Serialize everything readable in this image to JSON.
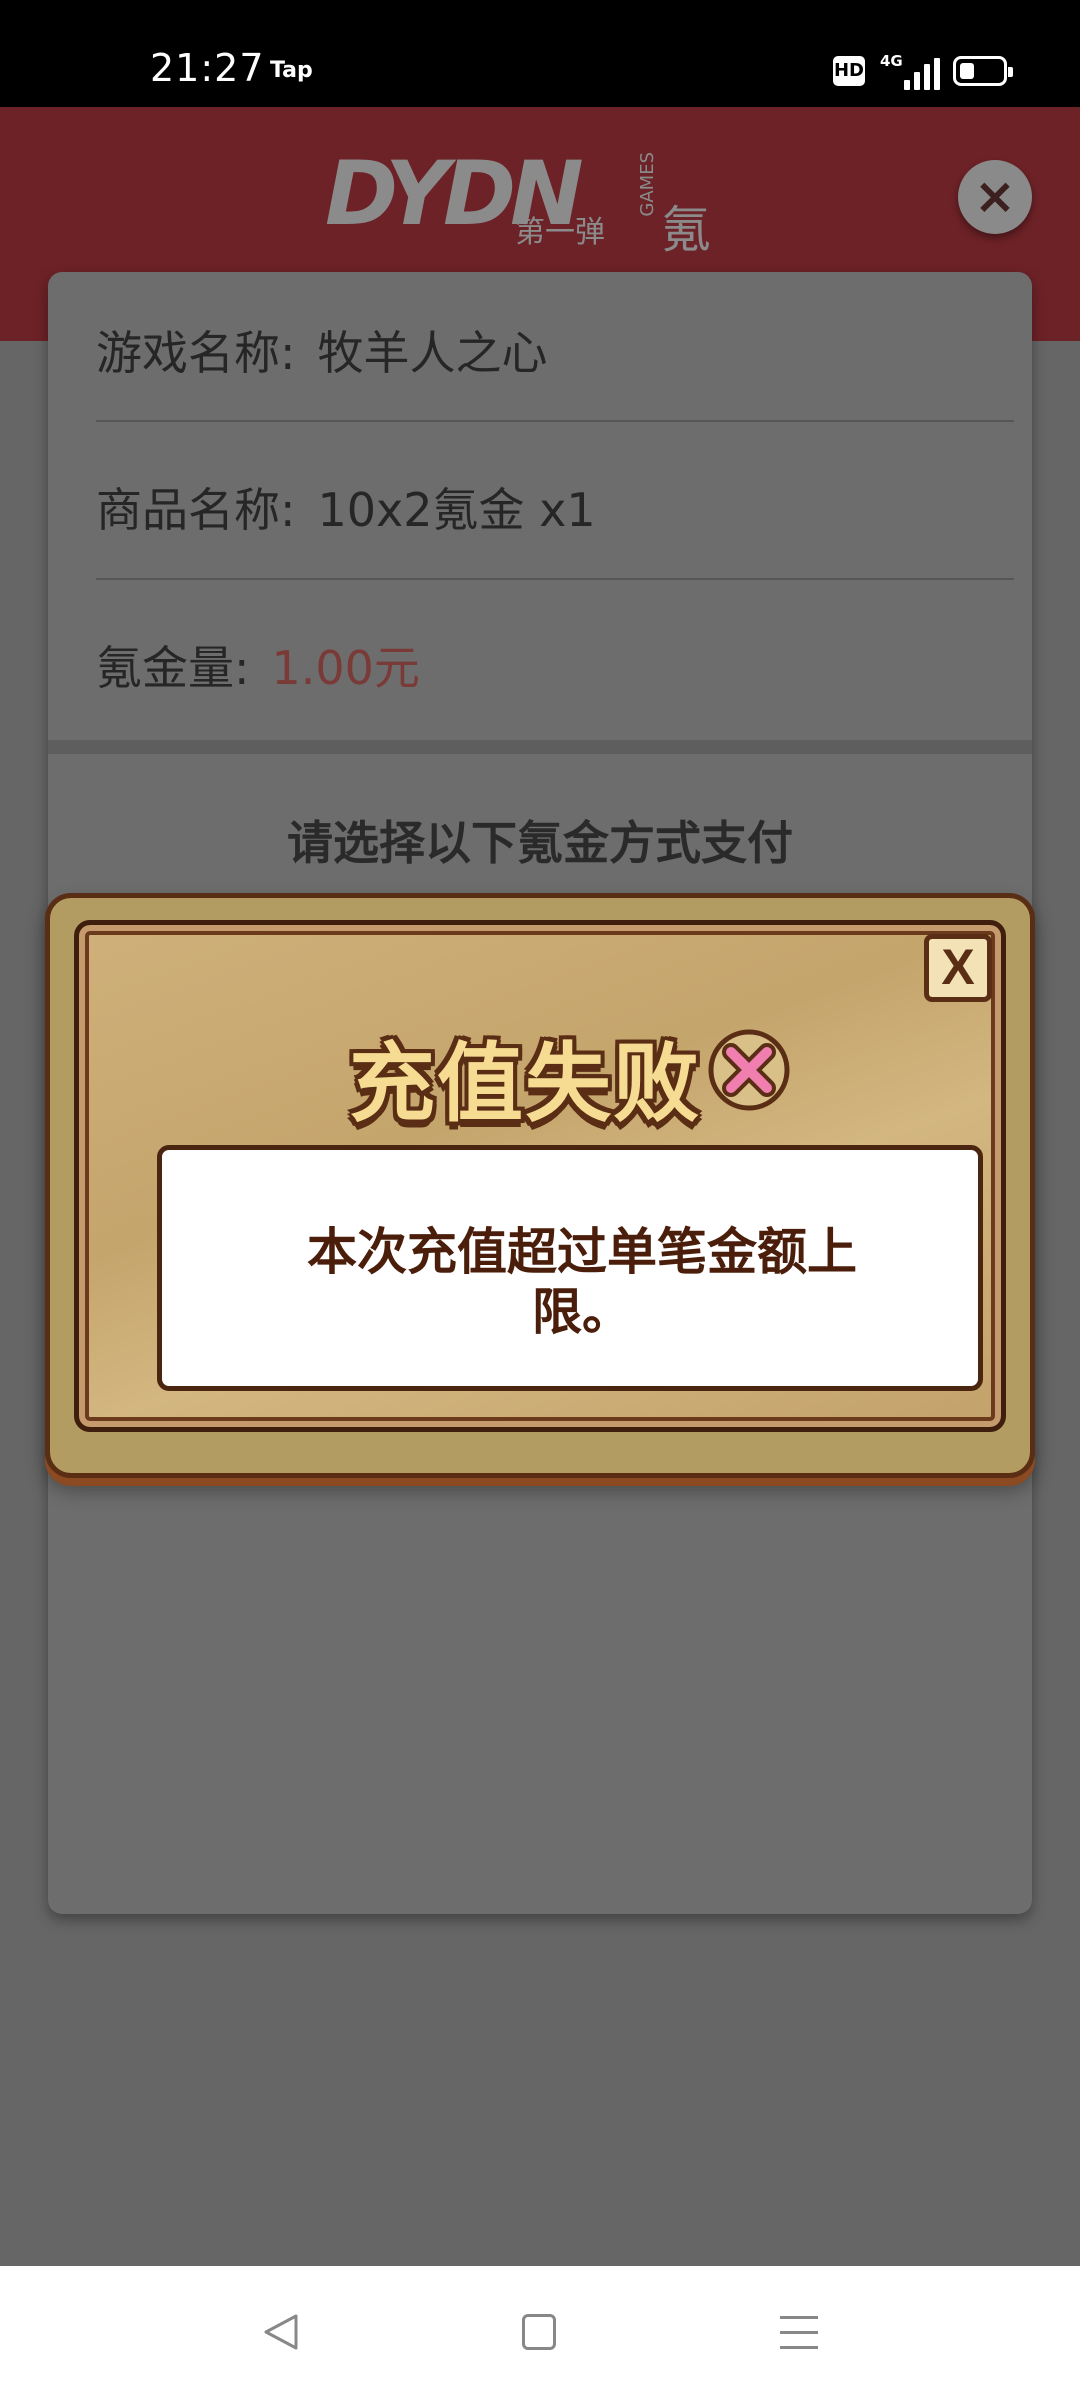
{
  "status_bar": {
    "time": "21:27",
    "app_tag": "Tap",
    "hd": "HD",
    "network": "4G"
  },
  "header": {
    "logo_letters": "DYDN",
    "logo_sub": "第一弹",
    "logo_games": "GAMES",
    "logo_suffix": "氪金",
    "close_icon": "×"
  },
  "order": {
    "game_label": "游戏名称:",
    "game_value": "牧羊人之心",
    "product_label": "商品名称:",
    "product_value": "10x2氪金 x1",
    "amount_label": "氪金量:",
    "amount_value": "1.00元",
    "choose_payment": "请选择以下氪金方式支付"
  },
  "modal": {
    "title": "充值失败",
    "close_label": "X",
    "message": "本次充值超过单笔金额上限。",
    "colors": {
      "frame": "#b39c61",
      "border": "#5a2d15",
      "title": "#f6dc93",
      "fail_icon": "#f07fb0"
    },
    "icon": "fail-x-icon"
  },
  "nav": {
    "back_icon": "back-triangle-icon",
    "home_icon": "home-square-icon",
    "menu_icon": "menu-lines-icon"
  }
}
